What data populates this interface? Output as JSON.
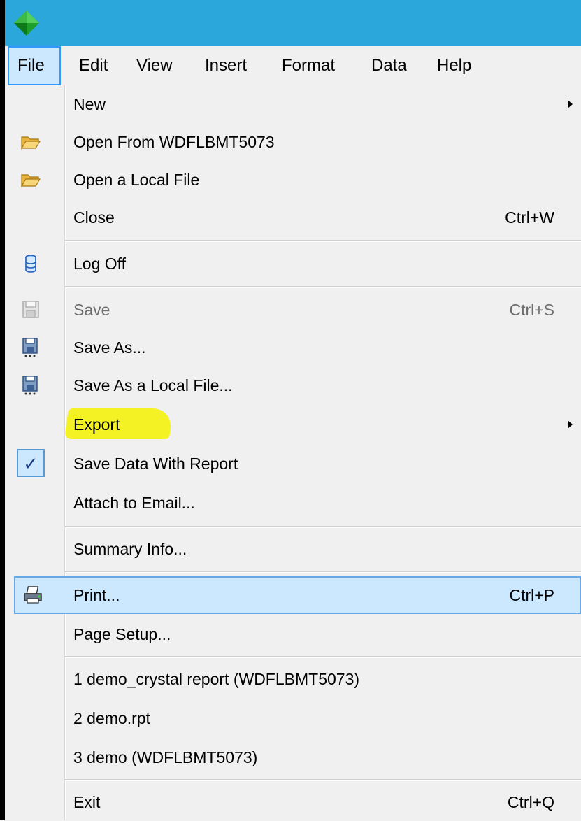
{
  "menubar": {
    "items": [
      "File",
      "Edit",
      "View",
      "Insert",
      "Format",
      "Data",
      "Help"
    ]
  },
  "file_menu": {
    "items": [
      {
        "label": "New",
        "submenu": true
      },
      {
        "label": "Open From WDFLBMT5073",
        "icon": "folder-open-icon"
      },
      {
        "label": "Open a Local File",
        "icon": "folder-open-icon"
      },
      {
        "label": "Close",
        "shortcut": "Ctrl+W"
      },
      {
        "label": "Log Off",
        "icon": "database-icon"
      },
      {
        "label": "Save",
        "shortcut": "Ctrl+S",
        "icon": "save-icon",
        "disabled": true
      },
      {
        "label": "Save As...",
        "icon": "save-as-icon"
      },
      {
        "label": "Save As a Local File...",
        "icon": "save-as-icon"
      },
      {
        "label": "Export",
        "submenu": true,
        "annotated": true
      },
      {
        "label": "Save Data With Report",
        "checked": true
      },
      {
        "label": "Attach to Email..."
      },
      {
        "label": "Summary Info..."
      },
      {
        "label": "Print...",
        "shortcut": "Ctrl+P",
        "icon": "printer-icon",
        "highlighted": true
      },
      {
        "label": "Page Setup..."
      },
      {
        "label": "1 demo_crystal report (WDFLBMT5073)"
      },
      {
        "label": "2 demo.rpt"
      },
      {
        "label": "3 demo (WDFLBMT5073)"
      },
      {
        "label": "Exit",
        "shortcut": "Ctrl+Q"
      }
    ]
  },
  "colors": {
    "titlebar": "#2ca7dc",
    "menu_background": "#f0f0f0",
    "highlight": "#cce8ff",
    "annotation": "#f4f200"
  }
}
